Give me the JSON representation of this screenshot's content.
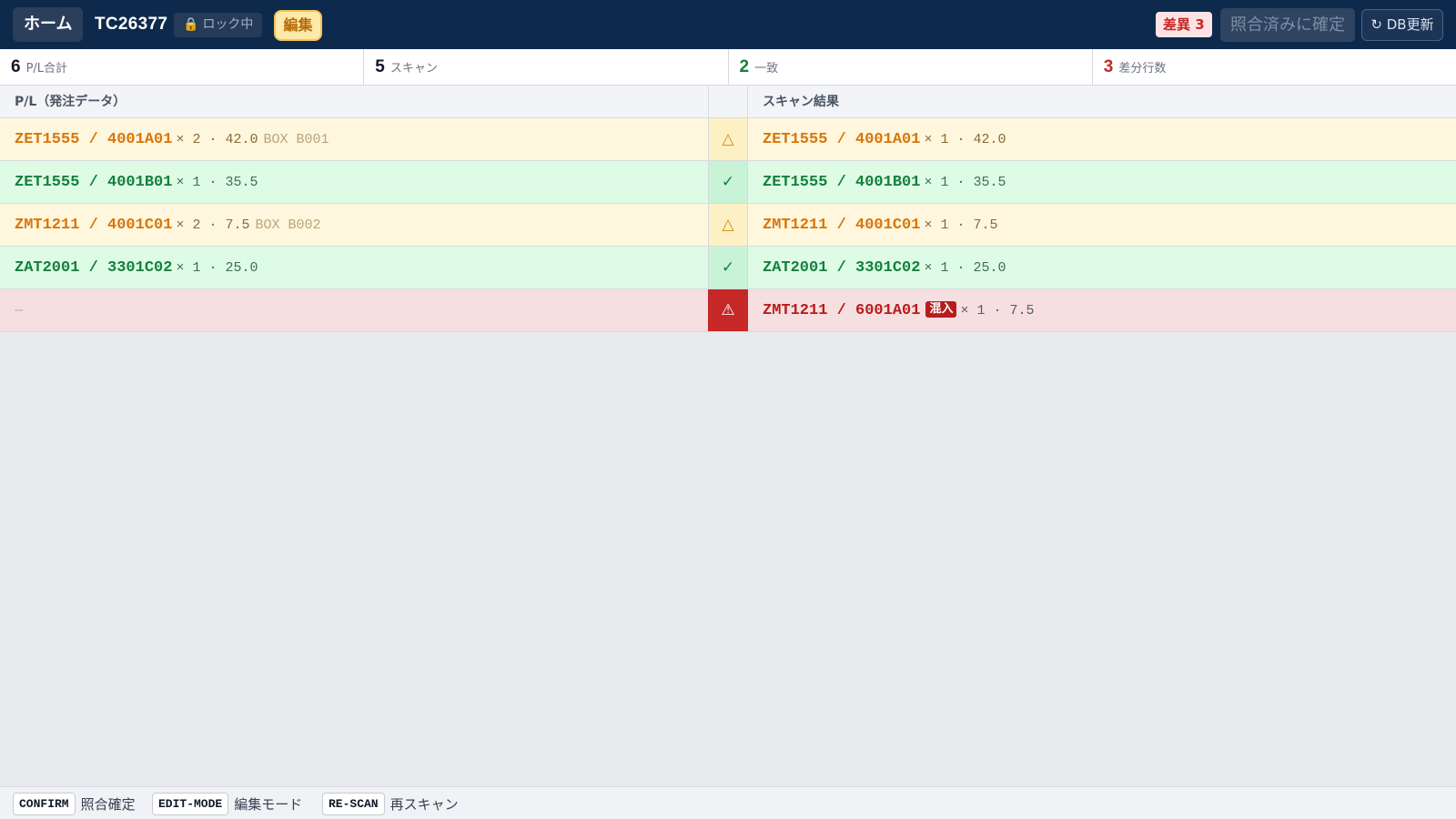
{
  "header": {
    "home_label": "ホーム",
    "doc_id": "TC26377",
    "lock_label": "ロック中",
    "edit_label": "編集",
    "diff_label": "差異 3",
    "confirm_label": "照合済みに確定",
    "refresh_label": "DB更新"
  },
  "stats": [
    {
      "value": "6",
      "label": "P/L合計"
    },
    {
      "value": "5",
      "label": "スキャン"
    },
    {
      "value": "2",
      "label": "一致"
    },
    {
      "value": "3",
      "label": "差分行数"
    }
  ],
  "table": {
    "left_header": "P/L（発注データ）",
    "right_header": "スキャン結果",
    "rows": [
      {
        "status": "warn",
        "status_icon": "△",
        "left": {
          "code": "ZET1555 / 4001A01",
          "meta": "× 2 · 42.0",
          "box": "BOX B001"
        },
        "right": {
          "code": "ZET1555 / 4001A01",
          "meta": "× 1 · 42.0"
        }
      },
      {
        "status": "ok",
        "status_icon": "✓",
        "left": {
          "code": "ZET1555 / 4001B01",
          "meta": "× 1 · 35.5",
          "box": ""
        },
        "right": {
          "code": "ZET1555 / 4001B01",
          "meta": "× 1 · 35.5"
        }
      },
      {
        "status": "warn",
        "status_icon": "△",
        "left": {
          "code": "ZMT1211 / 4001C01",
          "meta": "× 2 · 7.5",
          "box": "BOX B002"
        },
        "right": {
          "code": "ZMT1211 / 4001C01",
          "meta": "× 1 · 7.5"
        }
      },
      {
        "status": "ok",
        "status_icon": "✓",
        "left": {
          "code": "ZAT2001 / 3301C02",
          "meta": "× 1 · 25.0",
          "box": ""
        },
        "right": {
          "code": "ZAT2001 / 3301C02",
          "meta": "× 1 · 25.0"
        }
      },
      {
        "status": "err",
        "status_icon": "⚠",
        "left": {
          "empty": "—"
        },
        "right": {
          "code": "ZMT1211 / 6001A01",
          "tag": "混入",
          "meta": "× 1 · 7.5"
        }
      }
    ]
  },
  "footer": [
    {
      "key": "CONFIRM",
      "label": "照合確定"
    },
    {
      "key": "EDIT-MODE",
      "label": "編集モード"
    },
    {
      "key": "RE-SCAN",
      "label": "再スキャン"
    }
  ],
  "colors": {
    "header_bg": "#0d2a4d",
    "warn": "#d9760a",
    "ok": "#15803d",
    "error": "#b91c1c"
  }
}
